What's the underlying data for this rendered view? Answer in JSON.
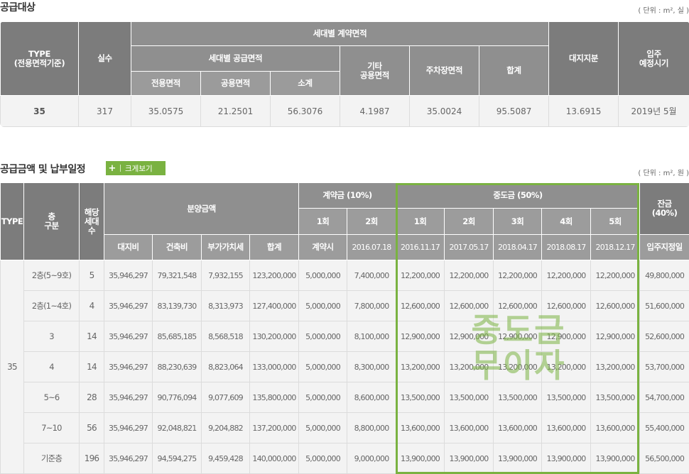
{
  "section1": {
    "title": "공급대상",
    "unit": "( 단위 : m², 실 )",
    "headers": {
      "type": "TYPE",
      "type_sub": "(전용면적기준)",
      "rooms": "실수",
      "contract_area": "세대별 계약면적",
      "supply_area": "세대별 공급면적",
      "exclusive": "전용면적",
      "common": "공용면적",
      "subtotal": "소계",
      "other_common_1": "기타",
      "other_common_2": "공용면적",
      "parking": "주차장면적",
      "total": "합계",
      "land_share": "대지지분",
      "move_in_1": "입주",
      "move_in_2": "예정시기"
    },
    "row": [
      "35",
      "317",
      "35.0575",
      "21.2501",
      "56.3076",
      "4.1987",
      "35.0024",
      "95.5087",
      "13.6915",
      "2019년 5월"
    ]
  },
  "section2": {
    "title": "공급금액 및 납부일정",
    "view_button": "크게보기",
    "plus_icon": "+",
    "unit": "( 단위 : m², 원 )",
    "headers": {
      "type": "TYPE",
      "floor_1": "층",
      "floor_2": "구분",
      "units_1": "해당",
      "units_2": "세대",
      "units_3": "수",
      "sale_price": "분양금액",
      "land": "대지비",
      "building": "건축비",
      "vat": "부가가치세",
      "sum": "합계",
      "deposit": "계약금 (10%)",
      "deposit_1": "1회",
      "deposit_2": "2회",
      "deposit_1_date": "계약시",
      "deposit_2_date": "2016.07.18",
      "middle": "중도금 (50%)",
      "middle_rounds": [
        "1회",
        "2회",
        "3회",
        "4회",
        "5회"
      ],
      "middle_dates": [
        "2016.11.17",
        "2017.05.17",
        "2018.04.17",
        "2018.08.17",
        "2018.12.17"
      ],
      "balance_1": "잔금",
      "balance_2": "(40%)",
      "balance_date": "입주지정일"
    },
    "type_value": "35",
    "rows": [
      [
        "2층(5~9호)",
        "5",
        "35,946,297",
        "79,321,548",
        "7,932,155",
        "123,200,000",
        "5,000,000",
        "7,400,000",
        "12,200,000",
        "12,200,000",
        "12,200,000",
        "12,200,000",
        "12,200,000",
        "49,800,000"
      ],
      [
        "2층(1~4호)",
        "4",
        "35,946,297",
        "83,139,730",
        "8,313,973",
        "127,400,000",
        "5,000,000",
        "7,800,000",
        "12,600,000",
        "12,600,000",
        "12,600,000",
        "12,600,000",
        "12,600,000",
        "51,600,000"
      ],
      [
        "3",
        "14",
        "35,946,297",
        "85,685,185",
        "8,568,518",
        "130,200,000",
        "5,000,000",
        "8,100,000",
        "12,900,000",
        "12,900,000",
        "12,900,000",
        "12,900,000",
        "12,900,000",
        "52,600,000"
      ],
      [
        "4",
        "14",
        "35,946,297",
        "88,230,639",
        "8,823,064",
        "133,000,000",
        "5,000,000",
        "8,300,000",
        "13,200,000",
        "13,200,000",
        "13,200,000",
        "13,200,000",
        "13,200,000",
        "53,700,000"
      ],
      [
        "5~6",
        "28",
        "35,946,297",
        "90,776,094",
        "9,077,609",
        "135,800,000",
        "5,000,000",
        "8,600,000",
        "13,500,000",
        "13,500,000",
        "13,500,000",
        "13,500,000",
        "13,500,000",
        "54,700,000"
      ],
      [
        "7~10",
        "56",
        "35,946,297",
        "92,048,821",
        "9,204,882",
        "137,200,000",
        "5,000,000",
        "8,800,000",
        "13,600,000",
        "13,600,000",
        "13,600,000",
        "13,600,000",
        "13,600,000",
        "55,400,000"
      ],
      [
        "기준층",
        "196",
        "35,946,297",
        "94,594,275",
        "9,459,428",
        "140,000,000",
        "5,000,000",
        "9,000,000",
        "13,900,000",
        "13,900,000",
        "13,900,000",
        "13,900,000",
        "13,900,000",
        "56,500,000"
      ]
    ],
    "watermark_1": "중도금",
    "watermark_2": "무이자"
  },
  "colors": {
    "accent_green": "#7ab241",
    "header_gray": "#8f8f8f",
    "cell_bg": "#f3f3f3"
  }
}
